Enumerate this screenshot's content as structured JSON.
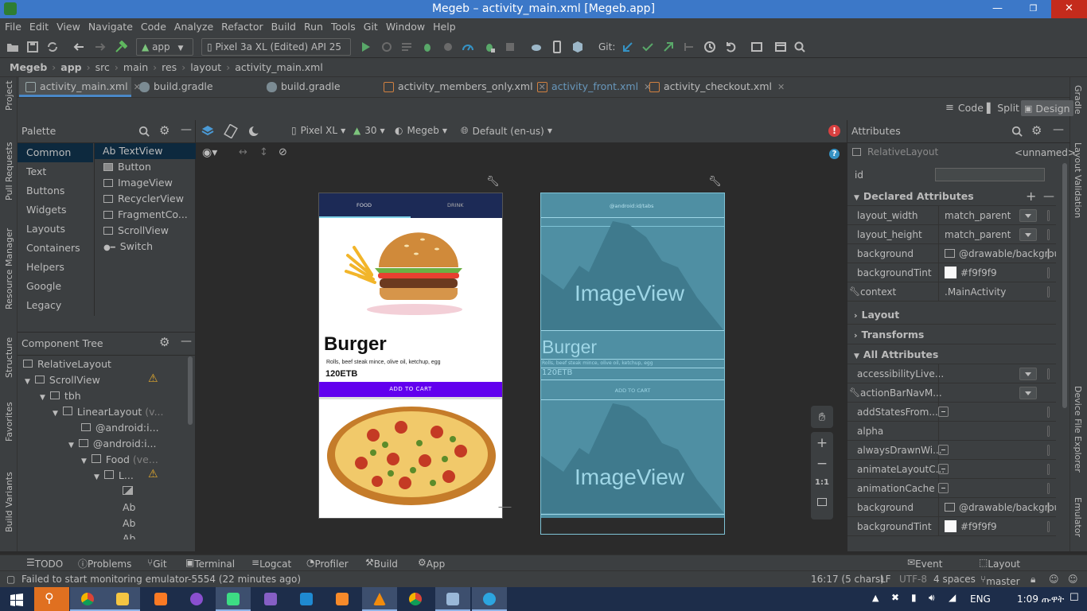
{
  "window": {
    "title": "Megeb – activity_main.xml [Megeb.app]"
  },
  "menu": [
    "File",
    "Edit",
    "View",
    "Navigate",
    "Code",
    "Analyze",
    "Refactor",
    "Build",
    "Run",
    "Tools",
    "Git",
    "Window",
    "Help"
  ],
  "toolbar": {
    "config": "app",
    "device": "Pixel 3a XL (Edited) API 25",
    "git_label": "Git:"
  },
  "breadcrumbs": [
    "Megeb",
    "app",
    "src",
    "main",
    "res",
    "layout",
    "activity_main.xml"
  ],
  "tabs": [
    {
      "label": "activity_main.xml",
      "active": true
    },
    {
      "label": "build.gradle (Megeb)"
    },
    {
      "label": "build.gradle (:app)"
    },
    {
      "label": "activity_members_only.xml"
    },
    {
      "label": "activity_front.xml"
    },
    {
      "label": "activity_checkout.xml"
    }
  ],
  "left_strip": [
    "Project",
    "Pull Requests",
    "Resource Manager",
    "Structure",
    "Favorites",
    "Build Variants"
  ],
  "right_strip": [
    "Gradle",
    "Layout Validation",
    "Device File Explorer",
    "Emulator"
  ],
  "view_modes": {
    "code": "Code",
    "split": "Split",
    "design": "Design"
  },
  "palette": {
    "title": "Palette",
    "categories": [
      "Common",
      "Text",
      "Buttons",
      "Widgets",
      "Layouts",
      "Containers",
      "Helpers",
      "Google",
      "Legacy"
    ],
    "items": [
      "TextView",
      "Button",
      "ImageView",
      "RecyclerView",
      "FragmentCo...",
      "ScrollView",
      "Switch"
    ],
    "text_prefix": "Ab"
  },
  "component_tree": {
    "title": "Component Tree",
    "nodes": [
      {
        "label": "RelativeLayout",
        "indent": 0
      },
      {
        "label": "ScrollView",
        "indent": 1,
        "warn": true
      },
      {
        "label": "tbh",
        "indent": 2
      },
      {
        "label": "LinearLayout",
        "extra": "(v...",
        "indent": 3
      },
      {
        "label": "@android:i...",
        "indent": 4
      },
      {
        "label": "@android:i...",
        "indent": 4
      },
      {
        "label": "Food",
        "extra": "(ve...",
        "indent": 5
      },
      {
        "label": "L...",
        "indent": 6,
        "warn": true
      },
      {
        "label": "",
        "indent": 7,
        "icon": "image"
      },
      {
        "label": "Ab",
        "indent": 7
      },
      {
        "label": "Ab",
        "indent": 7
      },
      {
        "label": "Ab",
        "indent": 7
      }
    ]
  },
  "design_toolbar": {
    "device": "Pixel XL",
    "api": "30",
    "theme": "Megeb",
    "locale": "Default (en-us)"
  },
  "preview": {
    "tabs": [
      "FOOD",
      "DRINK"
    ],
    "item_title": "Burger",
    "item_desc": "Rolls, beef steak mince, olive oil, ketchup, egg",
    "item_price": "120ETB",
    "add_button": "ADD TO CART"
  },
  "blueprint": {
    "header": "@android:id/tabs",
    "imageview": "ImageView",
    "title": "Burger",
    "desc": "Rolls, beef steak mince, olive oil, ketchup, egg",
    "price": "120ETB",
    "button": "ADD TO CART"
  },
  "zoom_controls": {
    "fit": "1:1"
  },
  "attributes": {
    "title": "Attributes",
    "component": "RelativeLayout",
    "component_name": "<unnamed>",
    "id_label": "id",
    "declared_title": "Declared Attributes",
    "declared": [
      {
        "k": "layout_width",
        "v": "match_parent",
        "dd": true
      },
      {
        "k": "layout_height",
        "v": "match_parent",
        "dd": true
      },
      {
        "k": "background",
        "v": "@drawable/backgrou",
        "img": true
      },
      {
        "k": "backgroundTint",
        "v": "#f9f9f9",
        "swatch": "#f9f9f9"
      },
      {
        "k": "context",
        "v": ".MainActivity",
        "wrench": true
      }
    ],
    "sections": [
      "Layout",
      "Transforms",
      "All Attributes"
    ],
    "all": [
      {
        "k": "accessibilityLive...",
        "v": "",
        "dd": true
      },
      {
        "k": "actionBarNavM...",
        "v": "",
        "dd": true,
        "wrench": true
      },
      {
        "k": "addStatesFrom...",
        "v": "",
        "minus": true
      },
      {
        "k": "alpha",
        "v": ""
      },
      {
        "k": "alwaysDrawnWi...",
        "v": "",
        "minus": true
      },
      {
        "k": "animateLayoutC...",
        "v": "",
        "minus": true
      },
      {
        "k": "animationCache",
        "v": "",
        "minus": true
      },
      {
        "k": "background",
        "v": "@drawable/backgrou",
        "img": true
      },
      {
        "k": "backgroundTint",
        "v": "#f9f9f9",
        "swatch": "#f9f9f9"
      }
    ]
  },
  "bottom_tabs": [
    "TODO",
    "Problems",
    "Git",
    "Terminal",
    "Logcat",
    "Profiler",
    "Build",
    "App Inspection",
    "Event Log",
    "Layout Inspector"
  ],
  "status": {
    "message": "Failed to start monitoring emulator-5554 (22 minutes ago)",
    "position": "16:17 (5 chars)",
    "line_sep": "LF",
    "encoding": "UTF-8",
    "indent": "4 spaces",
    "branch": "master"
  },
  "taskbar": {
    "lang": "ENG",
    "time": "1:09 ጡዋት"
  },
  "colors": {
    "accent": "#3c78c8",
    "button_purple": "#6200ee",
    "preview_header": "#1c2a56",
    "blueprint": "#4f8fa3",
    "warning": "#e0a82e",
    "error": "#d94040",
    "taskbar": "#1d2d4a"
  }
}
